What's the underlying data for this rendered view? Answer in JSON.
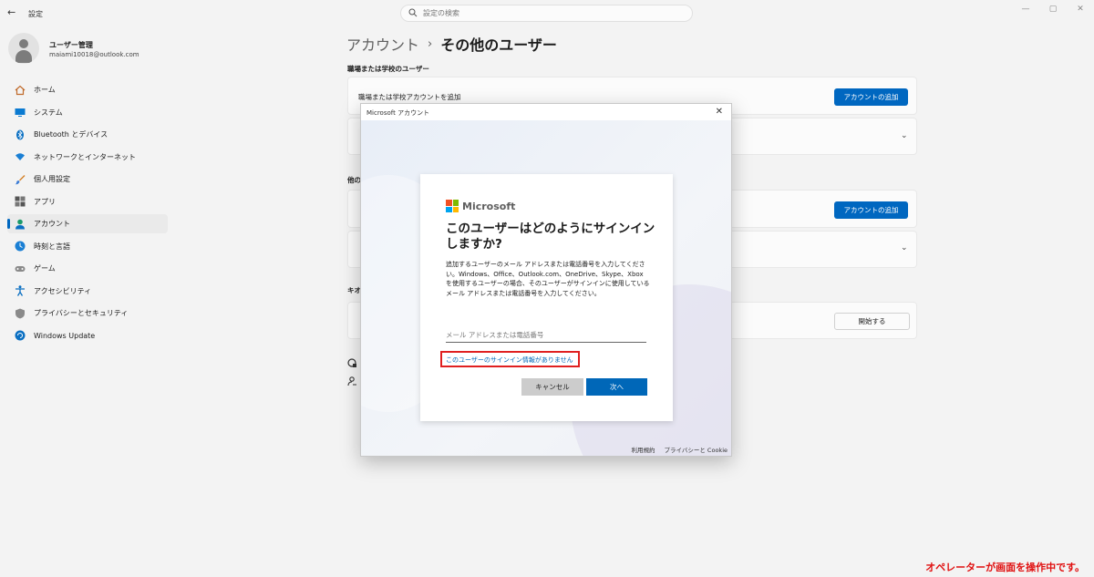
{
  "app": {
    "title": "設定"
  },
  "search": {
    "placeholder": "設定の検索"
  },
  "profile": {
    "name": "ユーザー管理",
    "email": "maiami10018@outlook.com"
  },
  "nav": {
    "items": [
      {
        "label": "ホーム",
        "icon": "home-icon",
        "color": "#c06a2a"
      },
      {
        "label": "システム",
        "icon": "system-icon",
        "color": "#0a7ad1"
      },
      {
        "label": "Bluetooth とデバイス",
        "icon": "bluetooth-icon",
        "color": "#0a6fc2"
      },
      {
        "label": "ネットワークとインターネット",
        "icon": "wifi-icon",
        "color": "#1a7fd4"
      },
      {
        "label": "個人用設定",
        "icon": "brush-icon",
        "color": "#d4822a"
      },
      {
        "label": "アプリ",
        "icon": "apps-icon",
        "color": "#555"
      },
      {
        "label": "アカウント",
        "icon": "account-icon",
        "color": "#1a9a6a",
        "active": true
      },
      {
        "label": "時刻と言語",
        "icon": "globe-clock-icon",
        "color": "#1a7fd4"
      },
      {
        "label": "ゲーム",
        "icon": "gamepad-icon",
        "color": "#777"
      },
      {
        "label": "アクセシビリティ",
        "icon": "accessibility-icon",
        "color": "#0a6fc2"
      },
      {
        "label": "プライバシーとセキュリティ",
        "icon": "shield-icon",
        "color": "#777"
      },
      {
        "label": "Windows Update",
        "icon": "update-icon",
        "color": "#0a6fc2"
      }
    ]
  },
  "breadcrumb": {
    "parent": "アカウント",
    "separator": "›",
    "current": "その他のユーザー"
  },
  "sections": {
    "work_school": "職場または学校のユーザー",
    "other_partial": "他の",
    "kiosk_partial": "キオ"
  },
  "cards": {
    "add_work_label": "職場または学校アカウントを追加",
    "add_account_button": "アカウントの追加",
    "add_account_button_2": "アカウントの追加",
    "start_button": "開始する"
  },
  "dialog": {
    "title": "Microsoft アカウント",
    "close": "✕",
    "brand": "Microsoft",
    "heading": "このユーザーはどのようにサインインしますか?",
    "description": "追加するユーザーのメール アドレスまたは電話番号を入力してください。Windows、Office、Outlook.com、OneDrive、Skype、Xbox を使用するユーザーの場合、そのユーザーがサインインに使用しているメール アドレスまたは電話番号を入力してください。",
    "email_placeholder": "メール アドレスまたは電話番号",
    "email_value": "",
    "no_info_link": "このユーザーのサインイン情報がありません",
    "cancel": "キャンセル",
    "next": "次へ",
    "footer_terms": "利用規約",
    "footer_privacy": "プライバシーと Cookie"
  },
  "operator_note": "オペレーターが画面を操作中です。",
  "colors": {
    "accent": "#0067c0",
    "highlight": "#e02020"
  }
}
